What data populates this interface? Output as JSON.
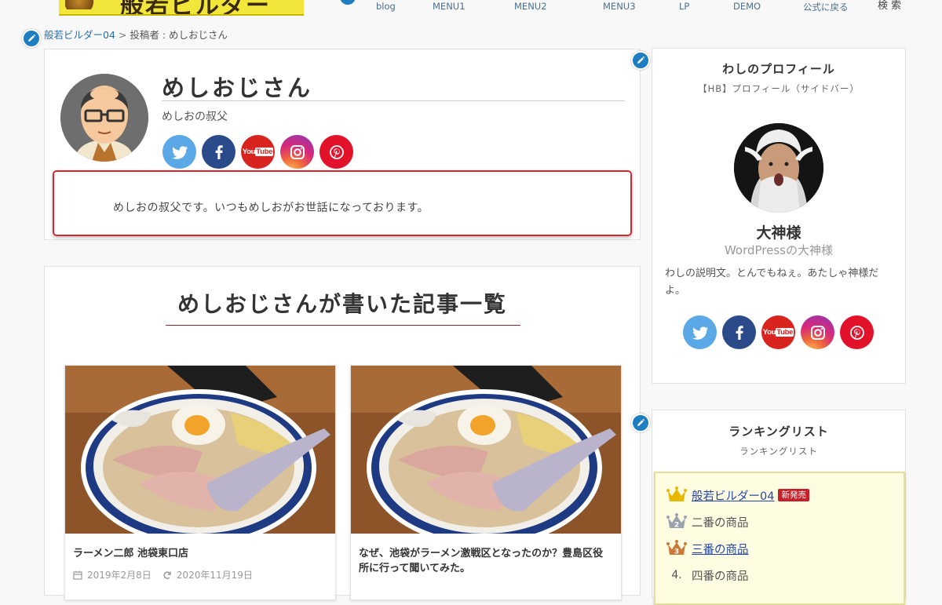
{
  "header": {
    "logo_text": "般若ビルダー",
    "nav": [
      "blog",
      "MENU1",
      "MENU2",
      "MENU3",
      "LP",
      "DEMO",
      "公式に戻る"
    ],
    "search_label": "検 索"
  },
  "breadcrumb": {
    "home": "般若ビルダー04",
    "separator": ">",
    "current": "投稿者 : めしおじさん"
  },
  "author": {
    "name": "めしおじさん",
    "subtitle": "めしおの叔父",
    "bio": "めしおの叔父です。いつもめしおがお世話になっております。",
    "sns": [
      "twitter",
      "facebook",
      "youtube",
      "instagram",
      "pinterest"
    ]
  },
  "articles": {
    "heading": "めしおじさんが書いた記事一覧",
    "posts": [
      {
        "title": "ラーメン二郎 池袋東口店",
        "date": "2019年2月8日",
        "updated": "2020年11月19日"
      },
      {
        "title": "なぜ、池袋がラーメン激戦区となったのか？豊島区役所に行って聞いてみた。",
        "date": "",
        "updated": ""
      }
    ]
  },
  "profile_widget": {
    "title": "わしのプロフィール",
    "subtitle": "【HB】プロフィール（サイドバー）",
    "name": "大神様",
    "role": "WordPressの大神様",
    "description": "わしの説明文。とんでもねぇ。あたしゃ神様だよ。",
    "sns": [
      "twitter",
      "facebook",
      "youtube",
      "instagram",
      "pinterest"
    ]
  },
  "ranking_widget": {
    "title": "ランキングリスト",
    "subtitle": "ランキングリスト",
    "items": [
      {
        "rank": "1",
        "label": "般若ビルダー04",
        "badge": "新発売",
        "link": true
      },
      {
        "rank": "2",
        "label": "二番の商品",
        "badge": "",
        "link": false
      },
      {
        "rank": "3",
        "label": "三番の商品",
        "badge": "",
        "link": true
      },
      {
        "rank": "4.",
        "label": "四番の商品",
        "badge": "",
        "link": false
      }
    ]
  },
  "colors": {
    "accent_blue": "#1f7dc1",
    "bio_border": "#d7262d",
    "heading_underline": "#a0212a",
    "ranking_bg": "#fffde1",
    "badge": "#c8202a"
  }
}
